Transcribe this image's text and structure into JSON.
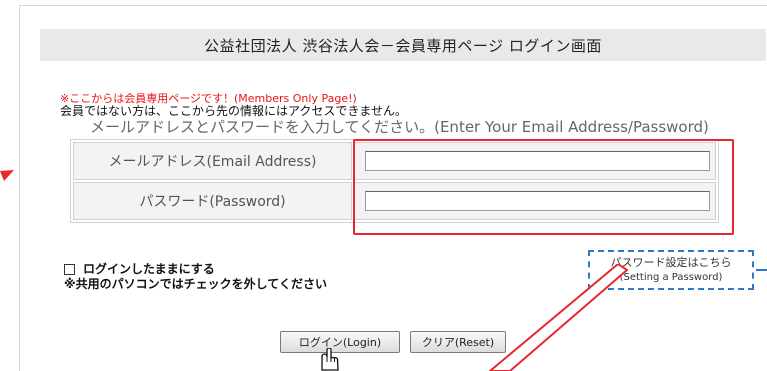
{
  "page": {
    "title": "公益社団法人 渋谷法人会－会員専用ページ ログイン画面"
  },
  "notice": {
    "members_only": "※ここからは会員専用ページです！(Members Only Page!)",
    "no_access": "会員ではない方は、ここから先の情報にはアクセスできません。"
  },
  "instruction": "メールアドレスとパスワードを入力してください。(Enter Your Email Address/Password)",
  "form": {
    "email_label": "メールアドレス(Email Address)",
    "email_value": "",
    "password_label": "パスワード(Password)",
    "password_value": ""
  },
  "password_setting": {
    "label": "パスワード設定はこちら",
    "sub": "(Setting a Password)"
  },
  "stay_logged_in": {
    "label": "ログインしたままにする",
    "note": "※共用のパソコンではチェックを外してください",
    "checked": false
  },
  "buttons": {
    "login": "ログイン(Login)",
    "reset": "クリア(Reset)"
  },
  "colors": {
    "highlight_red": "#e8262f",
    "notice_red": "#ee1111",
    "dashed_blue": "#2d7bc6",
    "title_bg": "#e9e9e9"
  }
}
